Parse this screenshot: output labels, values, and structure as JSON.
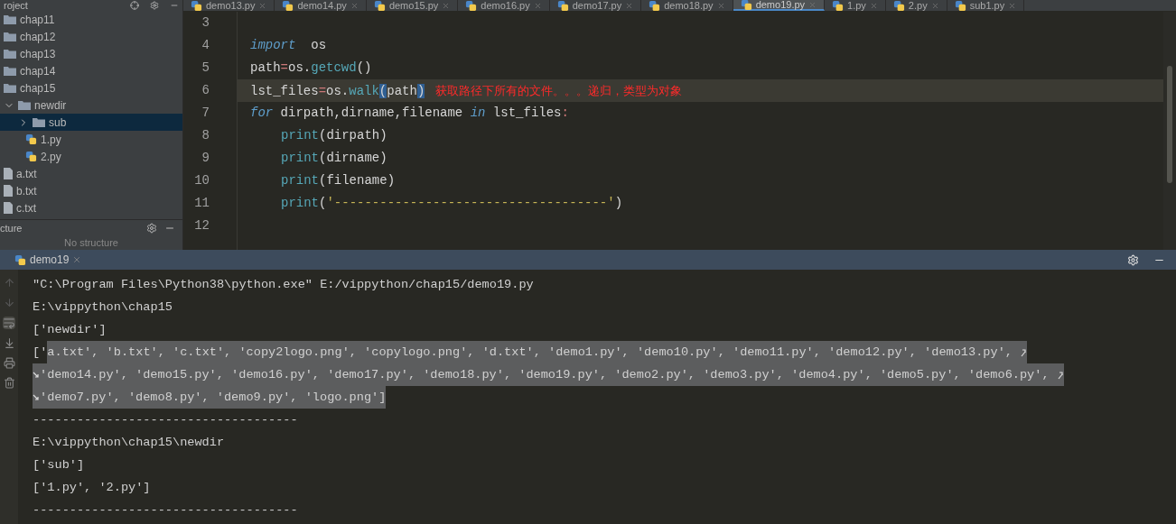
{
  "editor_tabs": [
    {
      "label": "demo13.py",
      "selected": false
    },
    {
      "label": "demo14.py",
      "selected": false
    },
    {
      "label": "demo15.py",
      "selected": false
    },
    {
      "label": "demo16.py",
      "selected": false
    },
    {
      "label": "demo17.py",
      "selected": false
    },
    {
      "label": "demo18.py",
      "selected": false
    },
    {
      "label": "demo19.py",
      "selected": true
    },
    {
      "label": "1.py",
      "selected": false
    },
    {
      "label": "2.py",
      "selected": false
    },
    {
      "label": "sub1.py",
      "selected": false
    }
  ],
  "project": {
    "title": "roject",
    "items": [
      {
        "label": "chap11",
        "kind": "folder",
        "selected": false
      },
      {
        "label": "chap12",
        "kind": "folder",
        "selected": false
      },
      {
        "label": "chap13",
        "kind": "folder",
        "selected": false
      },
      {
        "label": "chap14",
        "kind": "folder",
        "selected": false
      },
      {
        "label": "chap15",
        "kind": "folder",
        "selected": false
      },
      {
        "label": "newdir",
        "kind": "folder",
        "selected": false,
        "expanded": true,
        "children": [
          {
            "label": "sub",
            "kind": "folder",
            "selected": true,
            "expanded": false
          },
          {
            "label": "1.py",
            "kind": "python",
            "selected": false
          },
          {
            "label": "2.py",
            "kind": "python",
            "selected": false
          }
        ]
      },
      {
        "label": "a.txt",
        "kind": "text",
        "selected": false
      },
      {
        "label": "b.txt",
        "kind": "text",
        "selected": false
      },
      {
        "label": "c.txt",
        "kind": "text",
        "selected": false
      }
    ]
  },
  "structure": {
    "title": "cture",
    "empty_text": "No structure"
  },
  "code": [
    {
      "number": "3",
      "current": false
    },
    {
      "number": "4",
      "current": false,
      "tokens": [
        {
          "text": "import",
          "kind": "keyword"
        },
        {
          "text": "  os",
          "kind": "plain"
        }
      ]
    },
    {
      "number": "5",
      "current": false,
      "tokens": [
        {
          "text": "path",
          "kind": "plain"
        },
        {
          "text": "=",
          "kind": "op"
        },
        {
          "text": "os.",
          "kind": "plain"
        },
        {
          "text": "getcwd",
          "kind": "func"
        },
        {
          "text": "()",
          "kind": "plain"
        }
      ]
    },
    {
      "number": "6",
      "current": true,
      "tokens": [
        {
          "text": "lst_files",
          "kind": "plain"
        },
        {
          "text": "=",
          "kind": "op"
        },
        {
          "text": "os.",
          "kind": "plain"
        },
        {
          "text": "walk",
          "kind": "func"
        },
        {
          "text": "(",
          "kind": "match"
        },
        {
          "text": "path",
          "kind": "plain"
        },
        {
          "text": ")",
          "kind": "match"
        },
        {
          "text": "获取路径下所有的文件。。。递归，类型为对象",
          "kind": "note"
        }
      ]
    },
    {
      "number": "7",
      "current": false,
      "tokens": [
        {
          "text": "for",
          "kind": "keyword"
        },
        {
          "text": " dirpath,dirname,filename ",
          "kind": "plain"
        },
        {
          "text": "in",
          "kind": "keyword"
        },
        {
          "text": " lst_files",
          "kind": "plain"
        },
        {
          "text": ":",
          "kind": "op"
        }
      ]
    },
    {
      "number": "8",
      "current": false,
      "indent": true,
      "tokens": [
        {
          "text": "print",
          "kind": "func"
        },
        {
          "text": "(dirpath)",
          "kind": "plain"
        }
      ]
    },
    {
      "number": "9",
      "current": false,
      "indent": true,
      "tokens": [
        {
          "text": "print",
          "kind": "func"
        },
        {
          "text": "(dirname)",
          "kind": "plain"
        }
      ]
    },
    {
      "number": "10",
      "current": false,
      "indent": true,
      "tokens": [
        {
          "text": "print",
          "kind": "func"
        },
        {
          "text": "(filename)",
          "kind": "plain"
        }
      ]
    },
    {
      "number": "11",
      "current": false,
      "indent": true,
      "tokens": [
        {
          "text": "print",
          "kind": "func"
        },
        {
          "text": "(",
          "kind": "plain"
        },
        {
          "text": "'------------------------------------'",
          "kind": "string"
        },
        {
          "text": ")",
          "kind": "plain"
        }
      ]
    },
    {
      "number": "12",
      "current": false
    }
  ],
  "run": {
    "tab": "demo19",
    "lines": [
      {
        "wrap_start": false,
        "wrap_end": false,
        "parts": [
          {
            "text": "\"C:\\Program Files\\Python38\\python.exe\" E:/vippython/chap15/demo19.py",
            "selected": false
          }
        ]
      },
      {
        "wrap_start": false,
        "wrap_end": false,
        "parts": [
          {
            "text": "E:\\vippython\\chap15",
            "selected": false
          }
        ]
      },
      {
        "wrap_start": false,
        "wrap_end": false,
        "parts": [
          {
            "text": "['newdir']",
            "selected": false
          }
        ]
      },
      {
        "wrap_start": false,
        "wrap_end": true,
        "parts": [
          {
            "text": "['",
            "selected": false
          },
          {
            "text": "a.txt', 'b.txt', 'c.txt', 'copy2logo.png', 'copylogo.png', 'd.txt', 'demo1.py', 'demo10.py', 'demo11.py', 'demo12.py', 'demo13.py', ",
            "selected": true
          }
        ]
      },
      {
        "wrap_start": true,
        "wrap_end": true,
        "parts": [
          {
            "text": "'demo14.py', 'demo15.py', 'demo16.py', 'demo17.py', 'demo18.py', 'demo19.py', 'demo2.py', 'demo3.py', 'demo4.py', 'demo5.py', 'demo6.py', ",
            "selected": true
          }
        ]
      },
      {
        "wrap_start": true,
        "wrap_end": false,
        "parts": [
          {
            "text": "'demo7.py', 'demo8.py', 'demo9.py', 'logo.png']",
            "selected": true
          }
        ]
      },
      {
        "wrap_start": false,
        "wrap_end": false,
        "parts": [
          {
            "text": "------------------------------------",
            "selected": false
          }
        ]
      },
      {
        "wrap_start": false,
        "wrap_end": false,
        "parts": [
          {
            "text": "E:\\vippython\\chap15\\newdir",
            "selected": false
          }
        ]
      },
      {
        "wrap_start": false,
        "wrap_end": false,
        "parts": [
          {
            "text": "['sub']",
            "selected": false
          }
        ]
      },
      {
        "wrap_start": false,
        "wrap_end": false,
        "parts": [
          {
            "text": "['1.py', '2.py']",
            "selected": false
          }
        ]
      },
      {
        "wrap_start": false,
        "wrap_end": false,
        "parts": [
          {
            "text": "------------------------------------",
            "selected": false
          }
        ]
      }
    ]
  }
}
